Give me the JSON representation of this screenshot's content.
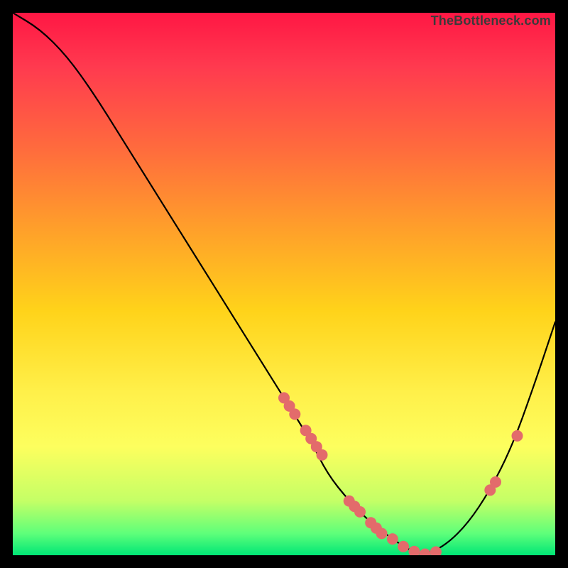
{
  "credit": "TheBottleneck.com",
  "colors": {
    "gradient_top": "#ff1744",
    "gradient_mid": "#ffd31a",
    "gradient_bottom": "#00e676",
    "curve": "#000000",
    "point": "#e36b6b",
    "frame": "#000000"
  },
  "chart_data": {
    "type": "line",
    "title": "",
    "xlabel": "",
    "ylabel": "",
    "xlim": [
      0,
      100
    ],
    "ylim": [
      0,
      100
    ],
    "series": [
      {
        "name": "curve",
        "x": [
          0,
          5,
          10,
          15,
          20,
          25,
          30,
          35,
          40,
          45,
          50,
          55,
          58,
          62,
          66,
          70,
          73,
          76,
          80,
          84,
          88,
          92,
          96,
          100
        ],
        "y": [
          100,
          97,
          92,
          85,
          77,
          69,
          61,
          53,
          45,
          37,
          29,
          21,
          15,
          10,
          6,
          3,
          1,
          0,
          2,
          6,
          12,
          20,
          31,
          43
        ]
      }
    ],
    "annotations": {
      "scatter_points": {
        "name": "highlighted-points",
        "x": [
          50,
          51,
          52,
          54,
          55,
          56,
          57,
          62,
          63,
          64,
          66,
          67,
          68,
          70,
          72,
          74,
          76,
          78,
          88,
          89,
          93
        ],
        "y": [
          29,
          27.5,
          26,
          23,
          21.5,
          20,
          18.5,
          10,
          9,
          8,
          6,
          5,
          4,
          3,
          1.6,
          0.7,
          0.2,
          0.6,
          12,
          13.5,
          22
        ]
      }
    }
  }
}
